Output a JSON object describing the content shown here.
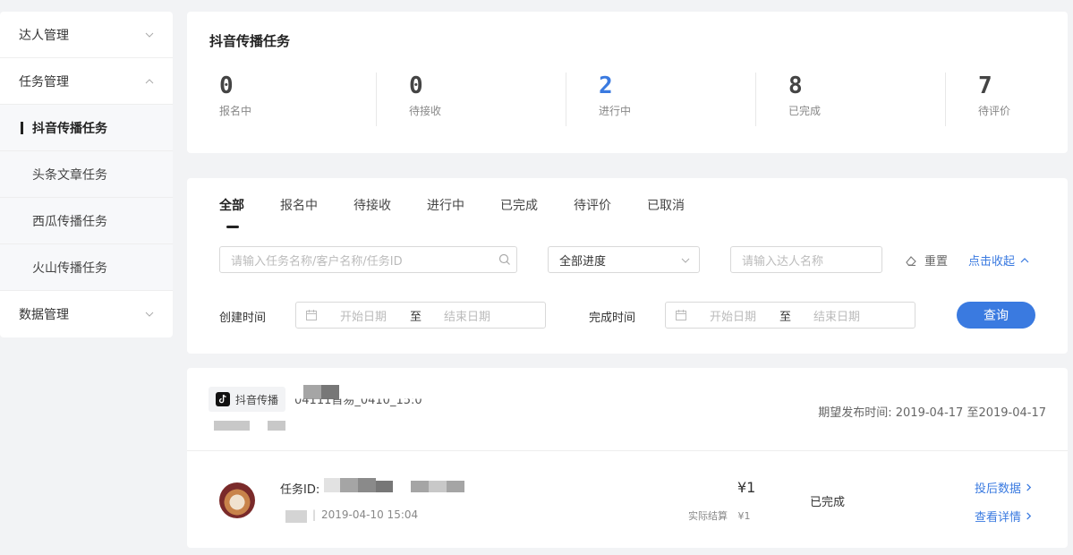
{
  "sidebar": {
    "groups": [
      {
        "label": "达人管理",
        "expanded": false
      },
      {
        "label": "任务管理",
        "expanded": true,
        "items": [
          "抖音传播任务",
          "头条文章任务",
          "西瓜传播任务",
          "火山传播任务"
        ]
      },
      {
        "label": "数据管理",
        "expanded": false
      }
    ],
    "active_item": "抖音传播任务"
  },
  "stats": {
    "title": "抖音传播任务",
    "items": [
      {
        "value": "0",
        "label": "报名中"
      },
      {
        "value": "0",
        "label": "待接收"
      },
      {
        "value": "2",
        "label": "进行中",
        "highlight": true
      },
      {
        "value": "8",
        "label": "已完成"
      },
      {
        "value": "7",
        "label": "待评价"
      }
    ]
  },
  "filters": {
    "tabs": [
      "全部",
      "报名中",
      "待接收",
      "进行中",
      "已完成",
      "待评价",
      "已取消"
    ],
    "active_tab": "全部",
    "search_placeholder": "请输入任务名称/客户名称/任务ID",
    "progress_select": "全部进度",
    "talent_placeholder": "请输入达人名称",
    "reset_label": "重置",
    "collapse_label": "点击收起",
    "create_time_label": "创建时间",
    "finish_time_label": "完成时间",
    "start_placeholder": "开始日期",
    "end_placeholder": "结束日期",
    "range_separator": "至",
    "query_label": "查询"
  },
  "task": {
    "platform_badge": "抖音传播",
    "title_fragment": "04111首易_0410_15:0",
    "expected_publish": "期望发布时间: 2019-04-17 至2019-04-17",
    "id_label": "任务ID:",
    "created_time": "2019-04-10 15:04",
    "price": "¥1",
    "actual_label": "实际结算",
    "actual_value": "¥1",
    "status": "已完成",
    "link_data": "投后数据",
    "link_detail": "查看详情"
  },
  "colors": {
    "accent": "#3a7ae0",
    "background": "#f2f3f5"
  }
}
